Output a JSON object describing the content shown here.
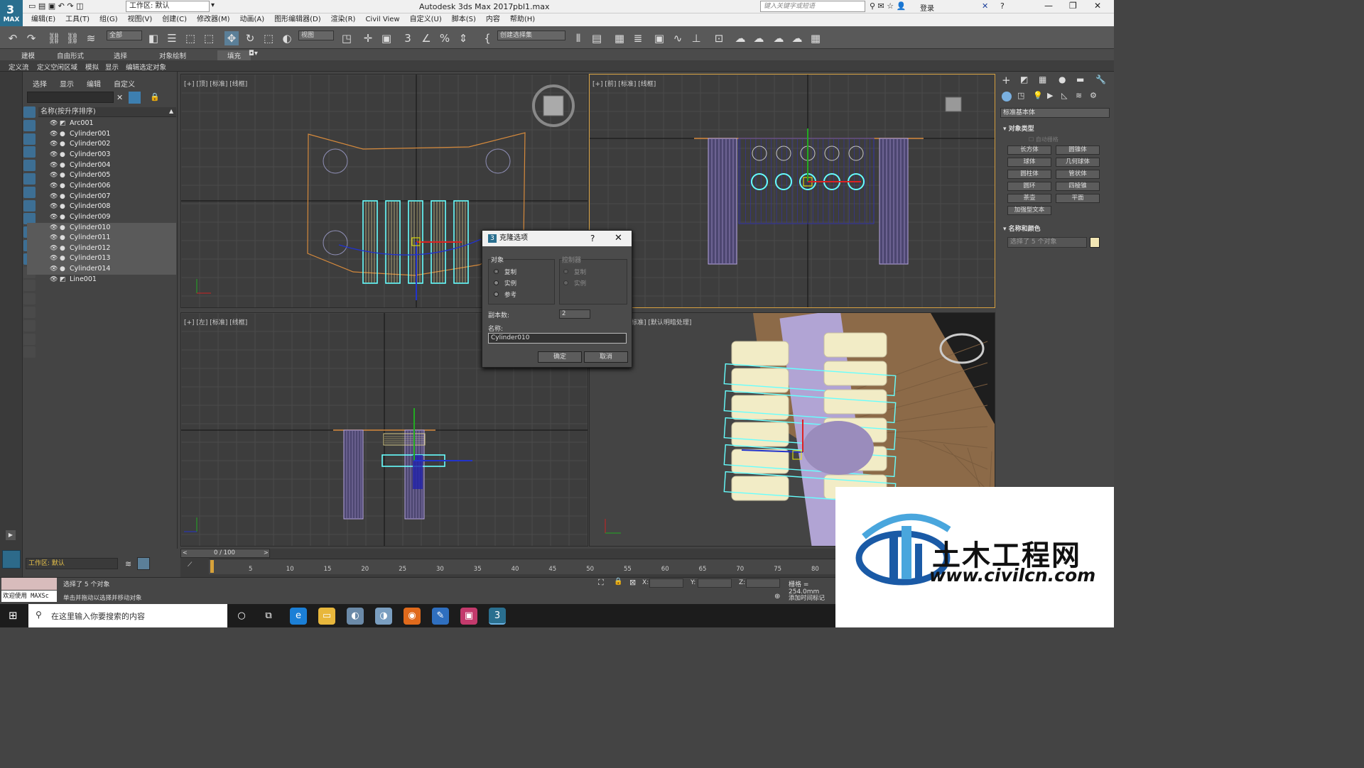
{
  "app": {
    "title": "Autodesk 3ds Max 2017",
    "file": "pbl1.max",
    "logo": "MAX",
    "workspace": "工作区: 默认",
    "search_placeholder": "键入关键字或短语",
    "login": "登录"
  },
  "menu": [
    "编辑(E)",
    "工具(T)",
    "组(G)",
    "视图(V)",
    "创建(C)",
    "修改器(M)",
    "动画(A)",
    "图形编辑器(D)",
    "渲染(R)",
    "Civil View",
    "自定义(U)",
    "脚本(S)",
    "内容",
    "帮助(H)"
  ],
  "toolbar": {
    "filter": "全部",
    "view": "视图",
    "selection_set": "创建选择集"
  },
  "ribbon": {
    "tabs": [
      "建模",
      "自由形式",
      "选择",
      "对象绘制",
      "填充"
    ],
    "sub": [
      "定义流",
      "定义空闲区域",
      "模拟",
      "显示",
      "编辑选定对象"
    ]
  },
  "scene_explorer": {
    "tabs": [
      "选择",
      "显示",
      "编辑",
      "自定义"
    ],
    "header": "名称(按升序排序)",
    "items": [
      {
        "name": "Arc001",
        "selected": false
      },
      {
        "name": "Cylinder001",
        "selected": false
      },
      {
        "name": "Cylinder002",
        "selected": false
      },
      {
        "name": "Cylinder003",
        "selected": false
      },
      {
        "name": "Cylinder004",
        "selected": false
      },
      {
        "name": "Cylinder005",
        "selected": false
      },
      {
        "name": "Cylinder006",
        "selected": false
      },
      {
        "name": "Cylinder007",
        "selected": false
      },
      {
        "name": "Cylinder008",
        "selected": false
      },
      {
        "name": "Cylinder009",
        "selected": false
      },
      {
        "name": "Cylinder010",
        "selected": true
      },
      {
        "name": "Cylinder011",
        "selected": true
      },
      {
        "name": "Cylinder012",
        "selected": true
      },
      {
        "name": "Cylinder013",
        "selected": true
      },
      {
        "name": "Cylinder014",
        "selected": true
      },
      {
        "name": "Line001",
        "selected": false
      }
    ]
  },
  "viewports": {
    "top": "[+] [顶] [标准] [线框]",
    "front": "[+] [前] [标准] [线框]",
    "left": "[+] [左] [标准] [线框]",
    "persp": "标准] [默认明暗处理]"
  },
  "dialog": {
    "title": "克隆选项",
    "help": "?",
    "object_group": "对象",
    "object_options": [
      "复制",
      "实例",
      "参考"
    ],
    "controller_group": "控制器",
    "controller_options": [
      "复制",
      "实例"
    ],
    "copies_label": "副本数:",
    "copies_value": "2",
    "name_label": "名称:",
    "name_value": "Cylinder010",
    "ok": "确定",
    "cancel": "取消"
  },
  "command_panel": {
    "category": "标准基本体",
    "rollout_object_type": "对象类型",
    "autogrid": "自动栅格",
    "buttons": [
      "长方体",
      "圆锥体",
      "球体",
      "几何球体",
      "圆柱体",
      "管状体",
      "圆环",
      "四棱锥",
      "茶壶",
      "平面",
      "加强型文本"
    ],
    "rollout_name_color": "名称和颜色",
    "name_field": "选择了 5 个对象",
    "swatch_color": "#f2e6b4"
  },
  "timeline": {
    "frame": "0 / 100",
    "ticks": [
      "5",
      "10",
      "15",
      "20",
      "25",
      "30",
      "35",
      "40",
      "45",
      "50",
      "55",
      "60",
      "65",
      "70",
      "75",
      "80"
    ]
  },
  "status": {
    "maxscript": "欢迎使用 MAXSc",
    "selected": "选择了 5 个对象",
    "prompt": "单击并拖动以选择并移动对象",
    "x": "X:",
    "y": "Y:",
    "z": "Z:",
    "grid": "栅格 = 254.0mm",
    "add_time_tag": "添加时间标记",
    "workspace_bottom": "工作区: 默认"
  },
  "taskbar": {
    "search": "在这里输入你要搜索的内容"
  },
  "watermark": {
    "brand": "土木工程网",
    "url": "www.civilcn.com"
  }
}
